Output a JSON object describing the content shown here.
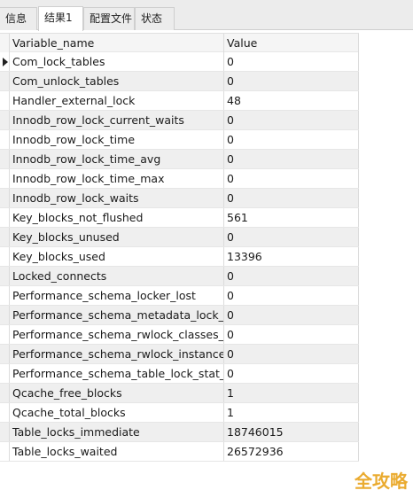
{
  "tabs": [
    {
      "label": "信息",
      "active": false
    },
    {
      "label": "结果1",
      "active": true
    },
    {
      "label": "配置文件",
      "active": false
    },
    {
      "label": "状态",
      "active": false
    }
  ],
  "table": {
    "columns": [
      "Variable_name",
      "Value"
    ],
    "rows": [
      {
        "name": "Com_lock_tables",
        "value": "0"
      },
      {
        "name": "Com_unlock_tables",
        "value": "0"
      },
      {
        "name": "Handler_external_lock",
        "value": "48"
      },
      {
        "name": "Innodb_row_lock_current_waits",
        "value": "0"
      },
      {
        "name": "Innodb_row_lock_time",
        "value": "0"
      },
      {
        "name": "Innodb_row_lock_time_avg",
        "value": "0"
      },
      {
        "name": "Innodb_row_lock_time_max",
        "value": "0"
      },
      {
        "name": "Innodb_row_lock_waits",
        "value": "0"
      },
      {
        "name": "Key_blocks_not_flushed",
        "value": "561"
      },
      {
        "name": "Key_blocks_unused",
        "value": "0"
      },
      {
        "name": "Key_blocks_used",
        "value": "13396"
      },
      {
        "name": "Locked_connects",
        "value": "0"
      },
      {
        "name": "Performance_schema_locker_lost",
        "value": "0"
      },
      {
        "name": "Performance_schema_metadata_lock_lost",
        "value": "0"
      },
      {
        "name": "Performance_schema_rwlock_classes_lost",
        "value": "0"
      },
      {
        "name": "Performance_schema_rwlock_instances_lo",
        "value": "0"
      },
      {
        "name": "Performance_schema_table_lock_stat_lost",
        "value": "0"
      },
      {
        "name": "Qcache_free_blocks",
        "value": "1"
      },
      {
        "name": "Qcache_total_blocks",
        "value": "1"
      },
      {
        "name": "Table_locks_immediate",
        "value": "18746015"
      },
      {
        "name": "Table_locks_waited",
        "value": "26572936"
      }
    ]
  },
  "watermark": "全攻略",
  "icons": {
    "row_marker": "current-row-triangle-icon"
  }
}
